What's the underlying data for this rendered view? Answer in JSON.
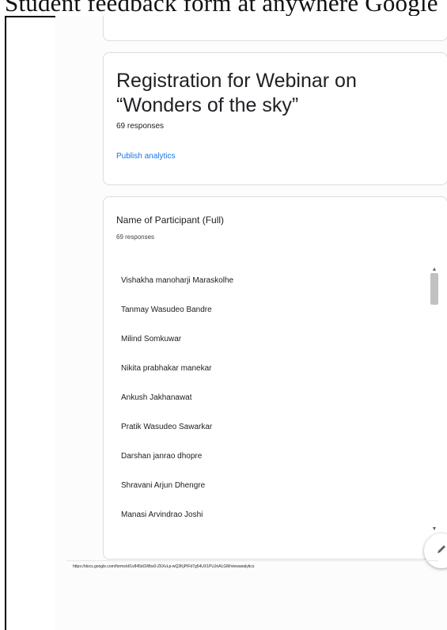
{
  "header_text": "Student feedback form at anywhere Google",
  "summary": {
    "title": "Registration for Webinar on “Wonders of the sky”",
    "responses": "69 responses",
    "publish_link": "Publish analytics"
  },
  "question": {
    "title": "Name of Participant (Full)",
    "responses": "69 responses",
    "answers": [
      "Vishakha manoharji Maraskolhe",
      "Tanmay Wasudeo Bandre",
      "Milind Somkuwar",
      "Nikita prabhakar manekar",
      "Ankush Jakhanawat",
      "Pratik Wasudeo Sawarkar",
      "Darshan janrao dhopre",
      "Shravani Arjun Dhengre",
      "Manasi Arvindrao Joshi"
    ]
  },
  "scrollbar": {
    "up_icon": "arrow-up-icon",
    "down_icon": "arrow-down-icon"
  },
  "fab_icon": "edit-pencil-icon",
  "footer_url": "https://docs.google.com/forms/d/1v845id1Wbs0-Z6XvLp-wQ2KjPIFd7g54UX1PUJnALGM/viewanalytics",
  "colors": {
    "link": "#1a73e8",
    "sidebar": "#272727",
    "card_border": "#dadce0"
  }
}
